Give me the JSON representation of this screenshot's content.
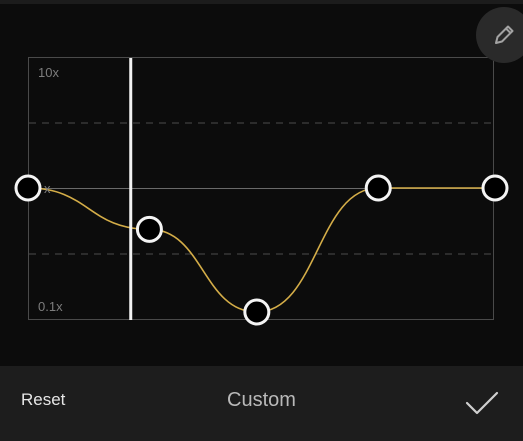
{
  "curve": {
    "y_max_label": "10x",
    "y_mid_label": "x",
    "y_min_label": "0.1x",
    "line_color": "#d4ad48",
    "points": [
      {
        "id": "point-1",
        "x": 0.0,
        "y": 1.0
      },
      {
        "id": "point-2",
        "x": 0.26,
        "y": 0.71
      },
      {
        "id": "point-3",
        "x": 0.49,
        "y": 0.13
      },
      {
        "id": "point-4",
        "x": 0.75,
        "y": 1.0
      },
      {
        "id": "point-5",
        "x": 1.0,
        "y": 1.0
      }
    ],
    "playhead_position": 0.22
  },
  "toolbar": {
    "reset_label": "Reset",
    "mode_label": "Custom",
    "confirm_icon": "checkmark-icon",
    "edit_icon": "pencil-icon"
  }
}
